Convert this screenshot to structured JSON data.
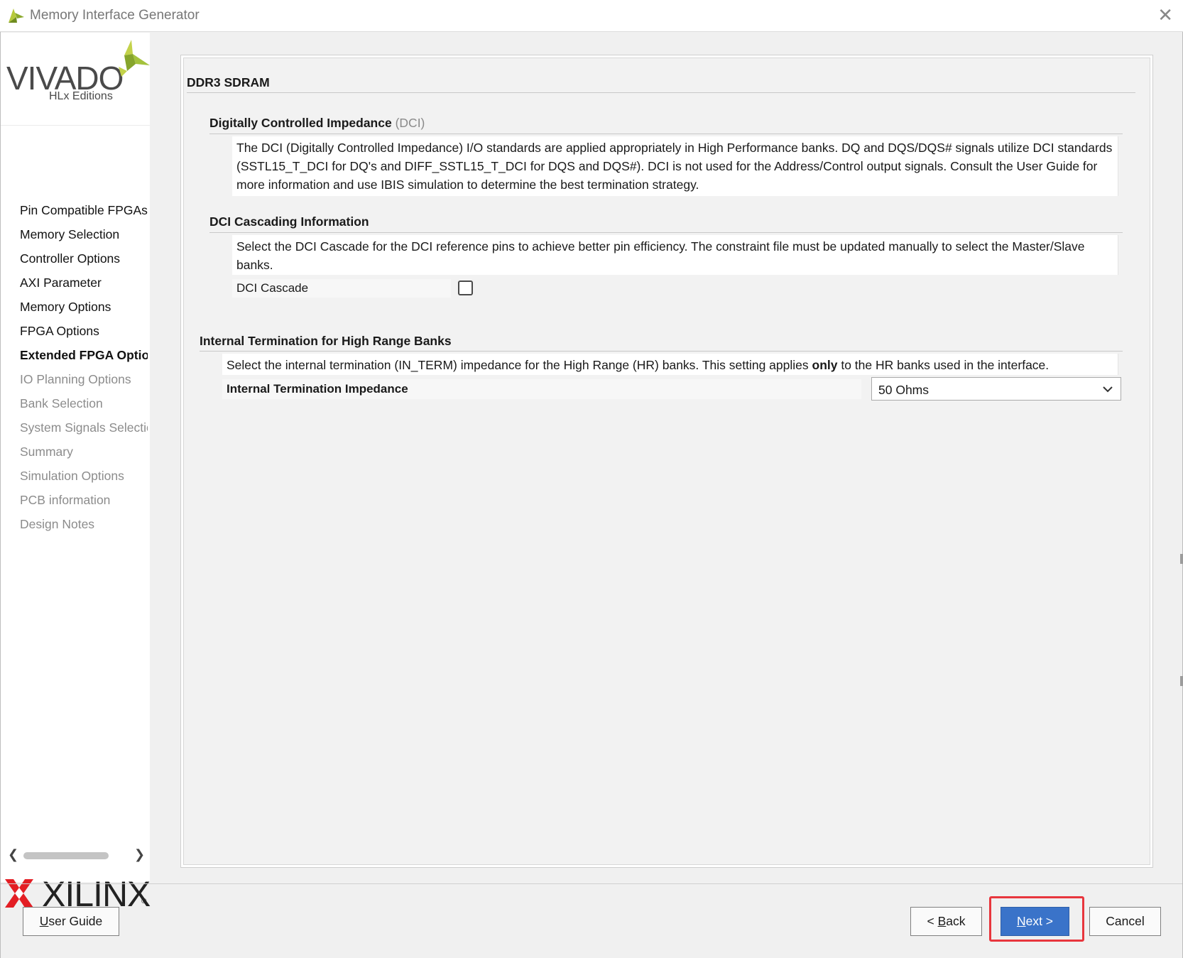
{
  "window": {
    "title": "Memory Interface Generator",
    "close_glyph": "✕"
  },
  "sidebar": {
    "logo": {
      "product": "VIVADO",
      "edition": "HLx Editions"
    },
    "items": [
      {
        "label": "Pin Compatible FPGAs",
        "state": "completed"
      },
      {
        "label": "Memory Selection",
        "state": "completed"
      },
      {
        "label": "Controller Options",
        "state": "completed"
      },
      {
        "label": "AXI Parameter",
        "state": "completed"
      },
      {
        "label": "Memory Options",
        "state": "completed"
      },
      {
        "label": "FPGA Options",
        "state": "completed"
      },
      {
        "label": "Extended FPGA Options",
        "state": "active"
      },
      {
        "label": "IO Planning Options",
        "state": "disabled"
      },
      {
        "label": "Bank Selection",
        "state": "disabled"
      },
      {
        "label": "System Signals Selection",
        "state": "disabled"
      },
      {
        "label": "Summary",
        "state": "disabled"
      },
      {
        "label": "Simulation Options",
        "state": "disabled"
      },
      {
        "label": "PCB information",
        "state": "disabled"
      },
      {
        "label": "Design Notes",
        "state": "disabled"
      }
    ],
    "scroll_left_glyph": "❮",
    "scroll_right_glyph": "❯",
    "footer_logo": {
      "brand": "XILINX",
      "registered": "®"
    }
  },
  "main": {
    "memory_type": "DDR3 SDRAM",
    "dci": {
      "title": "Digitally Controlled Impedance",
      "title_suffix": "(DCI)",
      "description": "The DCI (Digitally Controlled Impedance) I/O standards are applied appropriately in High Performance banks. DQ and DQS/DQS# signals utilize DCI standards (SSTL15_T_DCI for DQ's and DIFF_SSTL15_T_DCI for DQS and DQS#). DCI is not used for the Address/Control output signals. Consult the User Guide for more information and use IBIS simulation to determine the best termination strategy."
    },
    "dci_cascade": {
      "title": "DCI Cascading Information",
      "description": "Select the DCI Cascade for the DCI reference pins to achieve better pin efficiency. The constraint file must be updated manually to select the Master/Slave banks.",
      "checkbox_label": "DCI Cascade",
      "checked": false
    },
    "internal_termination": {
      "title": "Internal Termination for High Range Banks",
      "description_before": "Select the internal termination (IN_TERM) impedance for the High Range (HR) banks. This setting applies ",
      "description_bold": "only",
      "description_after": " to the HR banks used in the interface.",
      "field_label": "Internal Termination Impedance",
      "selected_value": "50 Ohms"
    }
  },
  "footer": {
    "user_guide_prefix": "",
    "user_guide_mnemonic": "U",
    "user_guide_rest": "ser Guide",
    "back_prefix": "< ",
    "back_mnemonic": "B",
    "back_rest": "ack",
    "next_mnemonic": "N",
    "next_rest": "ext >",
    "cancel_label": "Cancel"
  },
  "colors": {
    "primary_button": "#3a73c9",
    "highlight_frame": "#e8363d",
    "disabled_text": "#8c8c8c",
    "vivado_mark": "#a4c23c",
    "xilinx_mark": "#e31e24"
  }
}
